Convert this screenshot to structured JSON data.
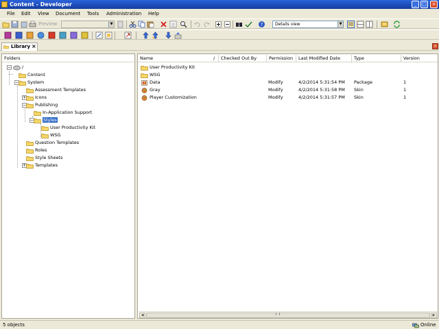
{
  "window": {
    "title": "Content - Developer",
    "controls": {
      "minimize": "_",
      "maximize": "□",
      "close": "×"
    }
  },
  "menu": [
    "File",
    "Edit",
    "View",
    "Document",
    "Tools",
    "Administration",
    "Help"
  ],
  "toolbar": {
    "preview_label": "Preview",
    "view_selected": "Details view"
  },
  "tabs": {
    "library_label": "Library",
    "close_glyph": "×"
  },
  "folders_pane": {
    "header": "Folders",
    "root": "/",
    "items": [
      "Content",
      "System",
      "Assessment Templates",
      "Icons",
      "Publishing",
      "In-Application Support",
      "Styles",
      "User Productivity Kit",
      "WSG",
      "Question Templates",
      "Roles",
      "Style Sheets",
      "Templates"
    ],
    "selected": "Styles"
  },
  "details_pane": {
    "columns": [
      "Name",
      "/",
      "Checked Out By",
      "Permission",
      "Last Modified Date",
      "Type",
      "Version"
    ],
    "rows": [
      {
        "name": "User Productivity Kit",
        "icon": "folder-icon",
        "checked_out_by": "",
        "permission": "",
        "modified": "",
        "type": "",
        "version": ""
      },
      {
        "name": "WSG",
        "icon": "folder-icon",
        "checked_out_by": "",
        "permission": "",
        "modified": "",
        "type": "",
        "version": ""
      },
      {
        "name": "Data",
        "icon": "package-icon",
        "checked_out_by": "",
        "permission": "Modify",
        "modified": "4/2/2014 5:31:54 PM",
        "type": "Package",
        "version": "1"
      },
      {
        "name": "Gray",
        "icon": "skin-icon",
        "checked_out_by": "",
        "permission": "Modify",
        "modified": "4/2/2014 5:31:58 PM",
        "type": "Skin",
        "version": "1"
      },
      {
        "name": "Player Customization",
        "icon": "skin-icon",
        "checked_out_by": "",
        "permission": "Modify",
        "modified": "4/2/2014 5:31:57 PM",
        "type": "Skin",
        "version": "1"
      }
    ],
    "scroll_grip": "III"
  },
  "status": {
    "count": "5 objects",
    "connection": "Online"
  },
  "colors": {
    "titlebar": "#1f4fbf",
    "selection": "#316ac5",
    "folder": "#f2d26b",
    "chrome": "#ece9d8"
  }
}
